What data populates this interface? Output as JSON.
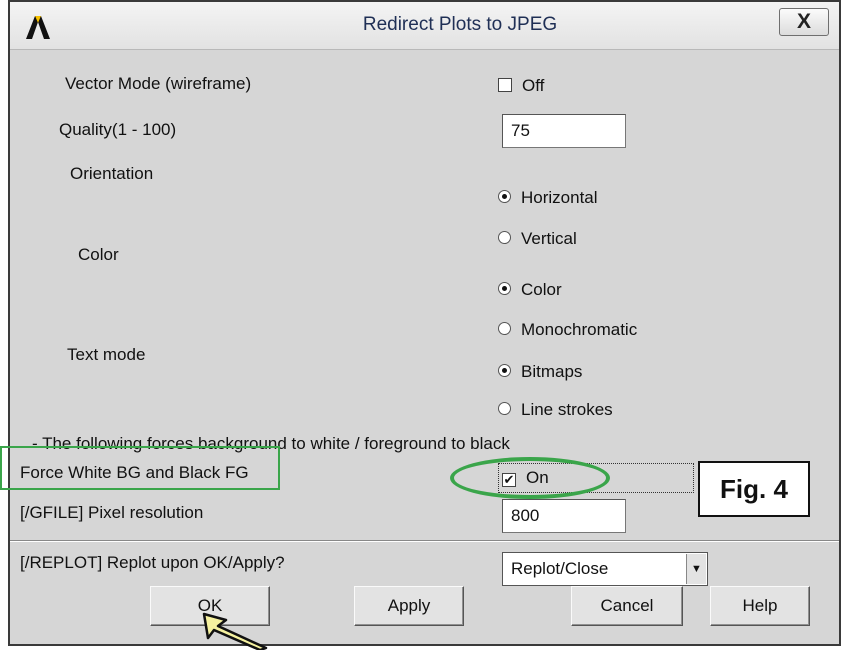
{
  "window": {
    "title": "Redirect Plots to JPEG",
    "close_label": "X"
  },
  "form": {
    "vector_mode_label": "Vector Mode (wireframe)",
    "vector_mode_value": "Off",
    "vector_mode_checked": false,
    "quality_label": "Quality(1 - 100)",
    "quality_value": "75",
    "orientation_label": "Orientation",
    "orientation_options": [
      "Horizontal",
      "Vertical"
    ],
    "orientation_selected": "Horizontal",
    "color_label": "Color",
    "color_options": [
      "Color",
      "Monochromatic"
    ],
    "color_selected": "Color",
    "text_mode_label": "Text mode",
    "text_mode_options": [
      "Bitmaps",
      "Line strokes"
    ],
    "text_mode_selected": "Bitmaps",
    "note": "- The following forces background to white / foreground to black",
    "force_label": "Force White BG and Black FG",
    "force_value": "On",
    "force_checked": true,
    "pixel_label": "[/GFILE]  Pixel resolution",
    "pixel_value": "800",
    "replot_label": "[/REPLOT] Replot upon OK/Apply?",
    "replot_selected": "Replot/Close"
  },
  "buttons": {
    "ok": "OK",
    "apply": "Apply",
    "cancel": "Cancel",
    "help": "Help"
  },
  "annotation": {
    "figure_label": "Fig. 4",
    "highlight_color": "#3aa54a",
    "pointer_color": "#f6f2a0"
  }
}
